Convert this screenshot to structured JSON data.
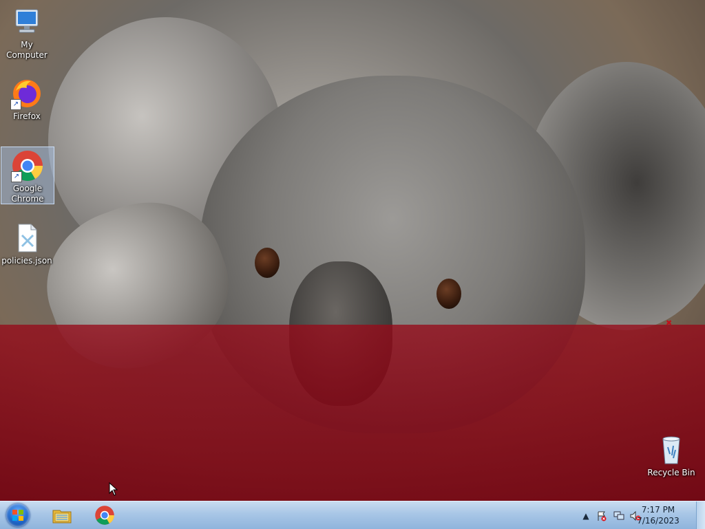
{
  "desktop": {
    "icons": [
      {
        "label": "My Computer",
        "icon": "computer-icon"
      },
      {
        "label": "Firefox",
        "icon": "firefox-icon"
      },
      {
        "label": "Google Chrome",
        "icon": "chrome-icon"
      },
      {
        "label": "policies.json",
        "icon": "json-file-icon"
      },
      {
        "label": "Recycle Bin",
        "icon": "recycle-bin-icon"
      }
    ]
  },
  "taskbar": {
    "start_icon": "windows-start-icon",
    "pinned": [
      {
        "name": "File Explorer",
        "icon": "folder-icon"
      },
      {
        "name": "Google Chrome",
        "icon": "chrome-icon"
      }
    ],
    "tray": {
      "icons": [
        "show-hidden-icons-arrow",
        "action-center-flag-icon",
        "network-icon",
        "volume-muted-icon"
      ],
      "time": "7:17 PM",
      "date": "7/16/2023"
    }
  },
  "colors": {
    "taskbar": "#a8c6e6",
    "wallpaper_tint": "#8a0a18",
    "selection": "#aac8f0"
  }
}
